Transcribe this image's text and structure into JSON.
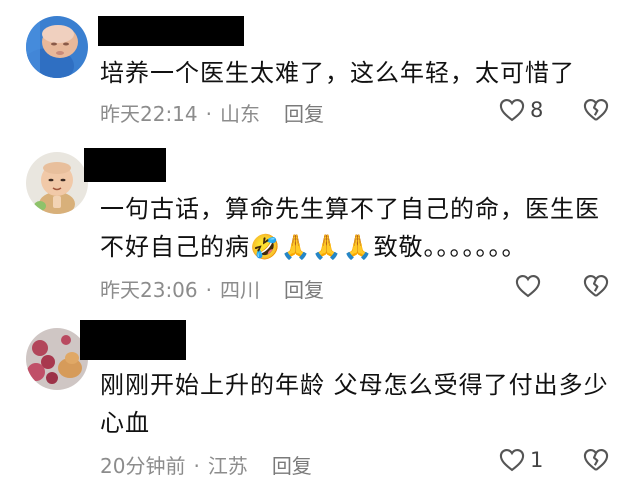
{
  "colors": {
    "background": "#ffffff",
    "text": "#111111",
    "meta": "#8c8c8c",
    "redaction": "#000000",
    "icon": "#555555"
  },
  "comments": [
    {
      "avatar": "baby-photo",
      "text": "培养一个医生太难了，这么年轻，太可惜了",
      "time": "昨天22:14",
      "location": "山东",
      "reply_label": "回复",
      "like_count": "8"
    },
    {
      "avatar": "monk-figurine-photo",
      "text_line1": "一句古话，算命先生算不了自己的命，医生医",
      "text_line2_start": "不好自己的病",
      "emojis": [
        "🤣",
        "🙏",
        "🙏",
        "🙏"
      ],
      "text_line2_end": "致敬。。。。。。。",
      "time": "昨天23:06",
      "location": "四川",
      "reply_label": "回复",
      "like_count": ""
    },
    {
      "avatar": "flower-cat-photo",
      "text": "刚刚开始上升的年龄 父母怎么受得了付出多少心血",
      "time": "20分钟前",
      "location": "江苏",
      "reply_label": "回复",
      "like_count": "1"
    }
  ],
  "separator": "·",
  "icons": {
    "like": "heart-outline-icon",
    "dislike": "broken-heart-icon"
  }
}
